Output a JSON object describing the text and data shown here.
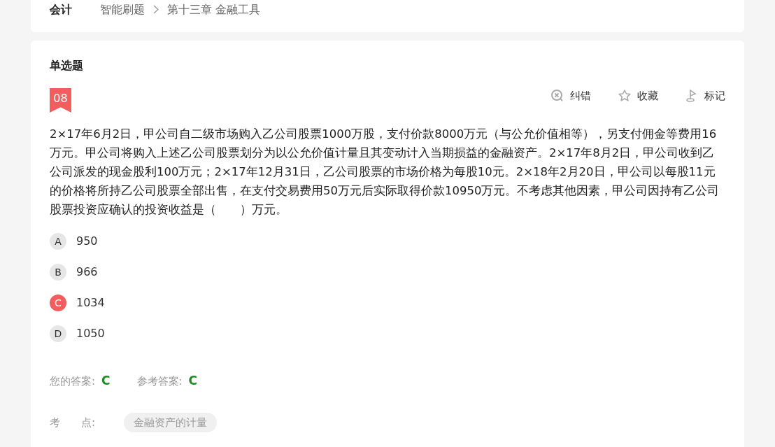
{
  "header": {
    "subject": "会计",
    "breadcrumb": [
      "智能刷题",
      "第十三章 金融工具"
    ]
  },
  "question": {
    "type": "单选题",
    "number": "08",
    "actions": [
      {
        "kind": "report",
        "label": "纠错"
      },
      {
        "kind": "favorite",
        "label": "收藏"
      },
      {
        "kind": "flag",
        "label": "标记"
      }
    ],
    "text": "2×17年6月2日，甲公司自二级市场购入乙公司股票1000万股，支付价款8000万元（与公允价值相等），另支付佣金等费用16万元。甲公司将购入上述乙公司股票划分为以公允价值计量且其变动计入当期损益的金融资产。2×17年8月2日，甲公司收到乙公司派发的现金股利100万元；2×17年12月31日，乙公司股票的市场价格为每股10元。2×18年2月20日，甲公司以每股11元的价格将所持乙公司股票全部出售，在支付交易费用50万元后实际取得价款10950万元。不考虑其他因素，甲公司因持有乙公司股票投资应确认的投资收益是（　　）万元。",
    "options": [
      {
        "letter": "A",
        "text": "950",
        "selected": false
      },
      {
        "letter": "B",
        "text": "966",
        "selected": false
      },
      {
        "letter": "C",
        "text": "1034",
        "selected": true
      },
      {
        "letter": "D",
        "text": "1050",
        "selected": false
      }
    ],
    "your_answer": {
      "label": "您的答案:",
      "value": "C"
    },
    "reference_answer": {
      "label": "参考答案:",
      "value": "C"
    },
    "knowledge_point": {
      "label": "考　　点:",
      "tags": [
        "金融资产的计量"
      ]
    }
  }
}
